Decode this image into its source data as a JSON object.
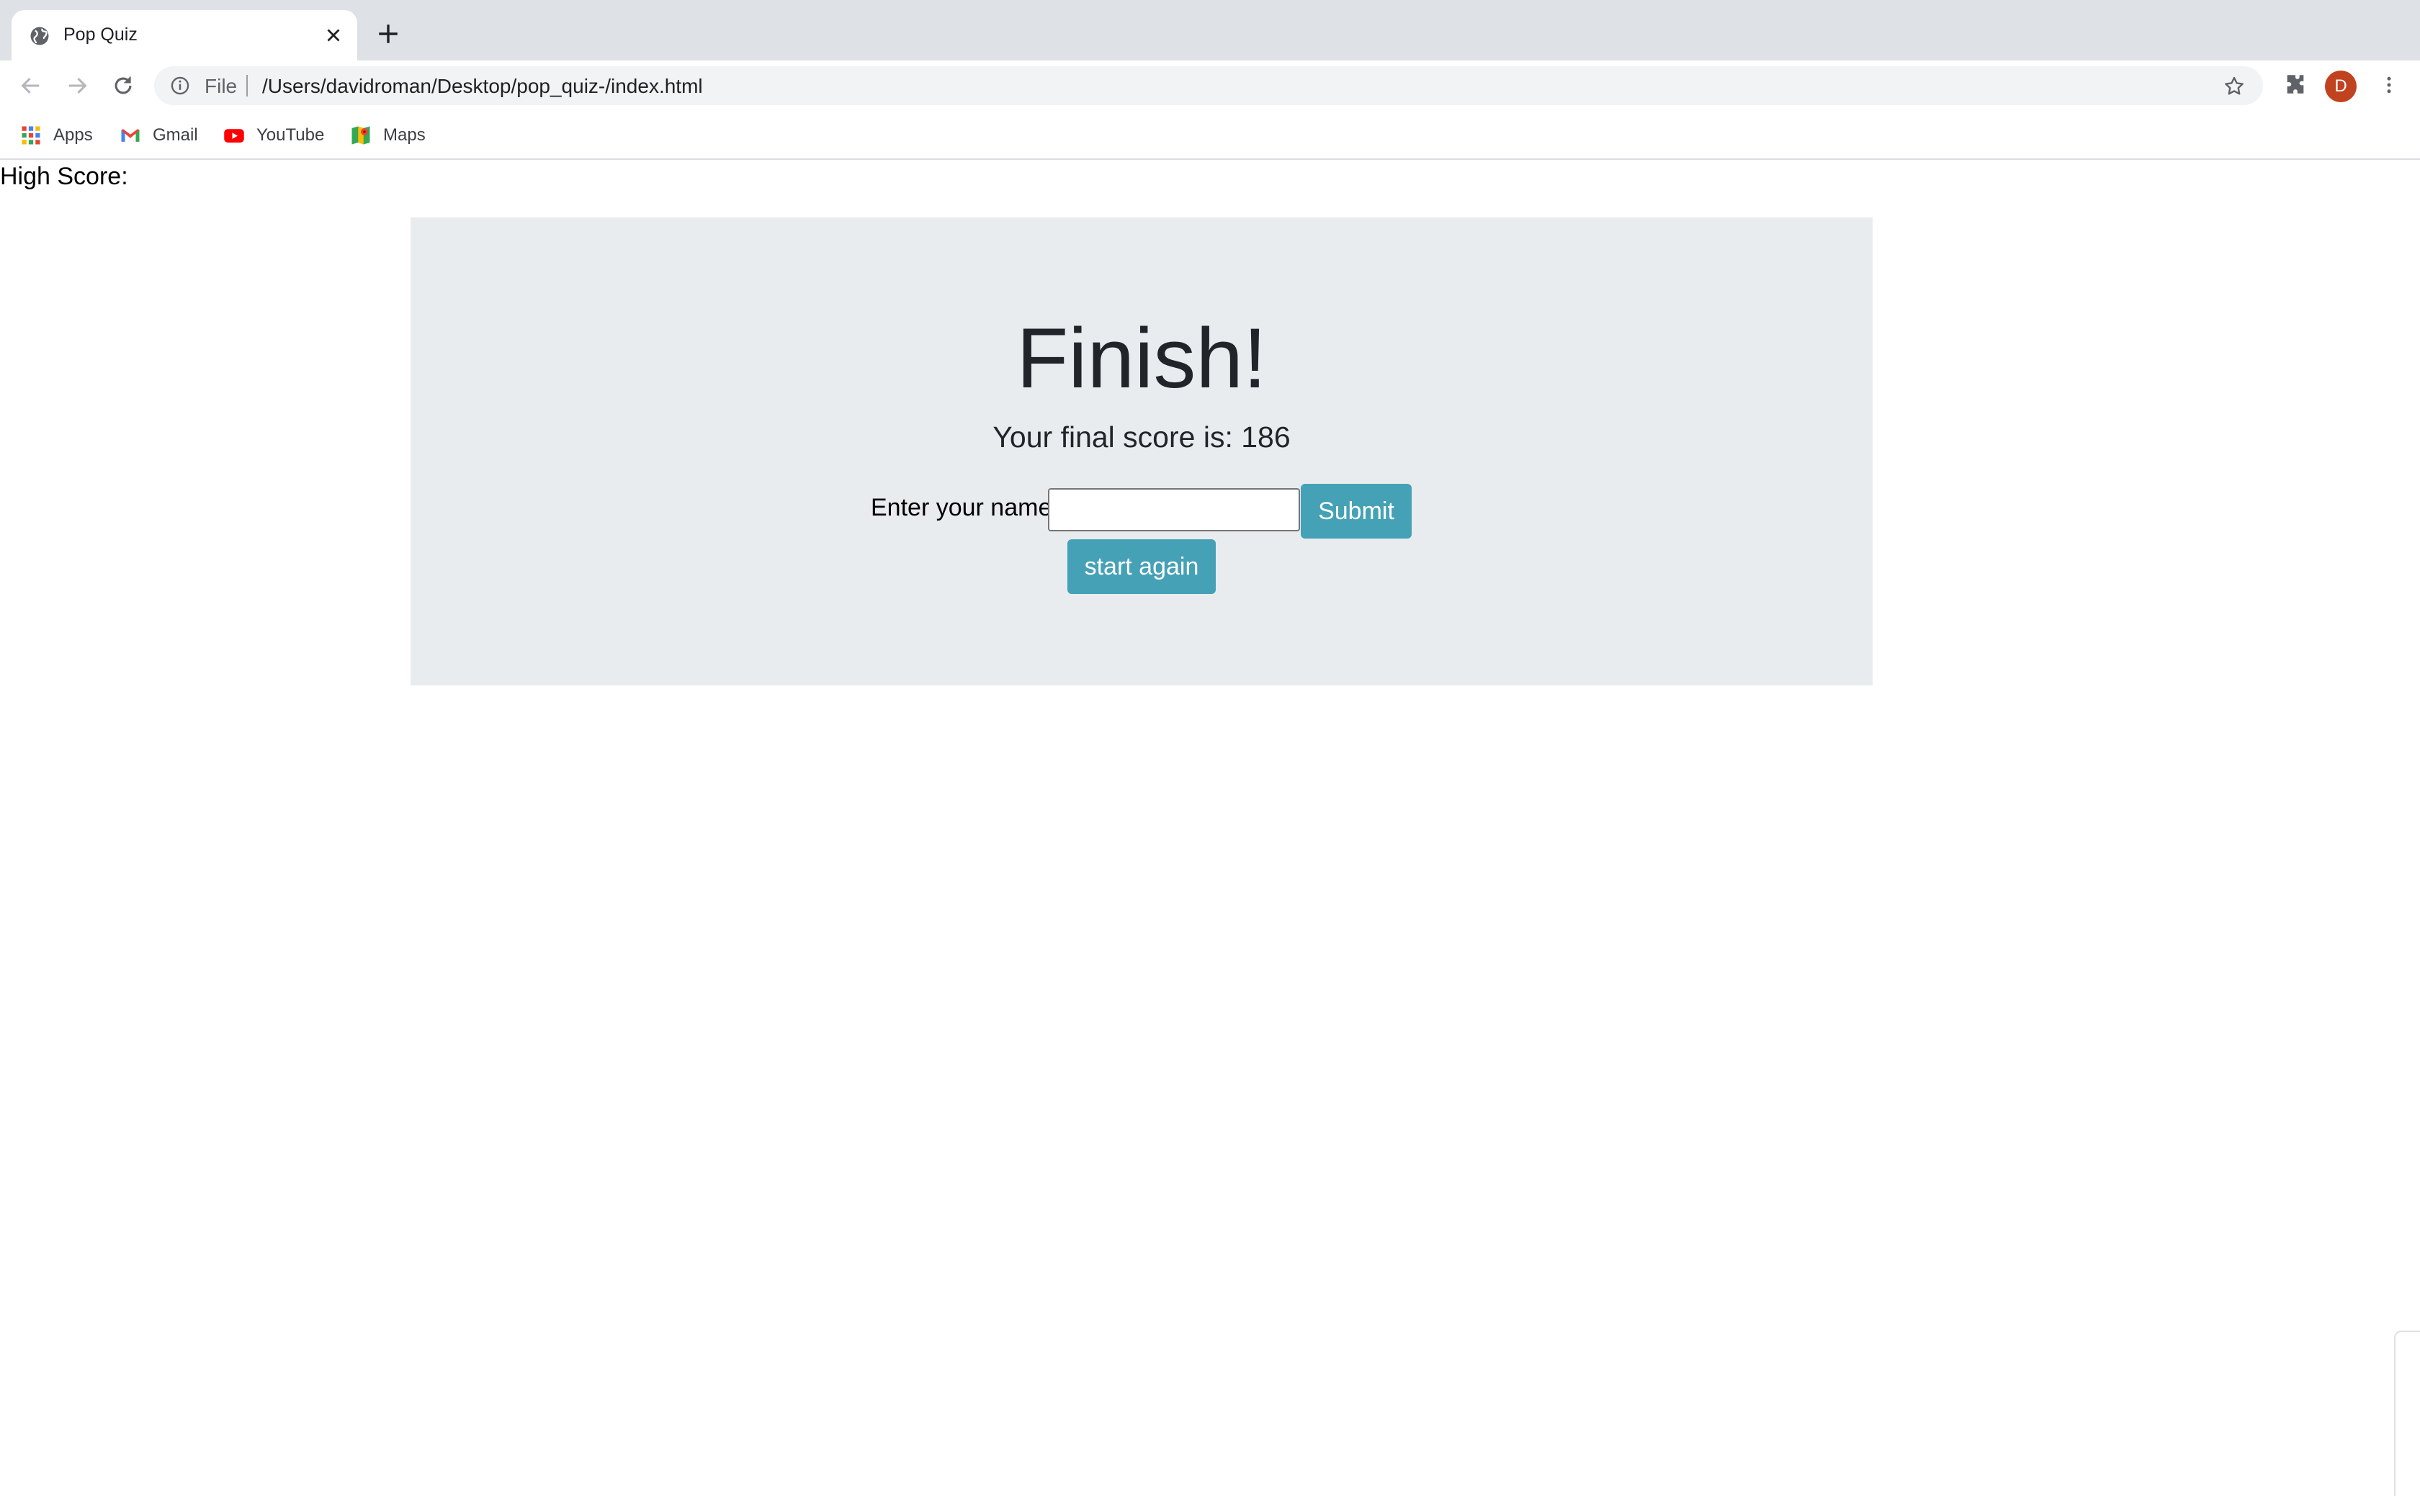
{
  "browser": {
    "tab": {
      "title": "Pop Quiz"
    },
    "omnibox": {
      "scheme": "File",
      "url": "/Users/davidroman/Desktop/pop_quiz-/index.html"
    },
    "profile_initial": "D",
    "bookmarks": [
      {
        "label": "Apps",
        "icon": "apps-grid-icon"
      },
      {
        "label": "Gmail",
        "icon": "gmail-icon"
      },
      {
        "label": "YouTube",
        "icon": "youtube-icon"
      },
      {
        "label": "Maps",
        "icon": "maps-icon"
      }
    ]
  },
  "page": {
    "high_score_label": "High Score:",
    "title": "Finish!",
    "final_score_text": "Your final score is: 186",
    "name_label": "Enter your name:",
    "name_value": "",
    "submit_label": "Submit",
    "start_again_label": "start again"
  },
  "colors": {
    "button": "#45a1b5",
    "panel": "#e9ecef",
    "avatar": "#c0421e"
  }
}
